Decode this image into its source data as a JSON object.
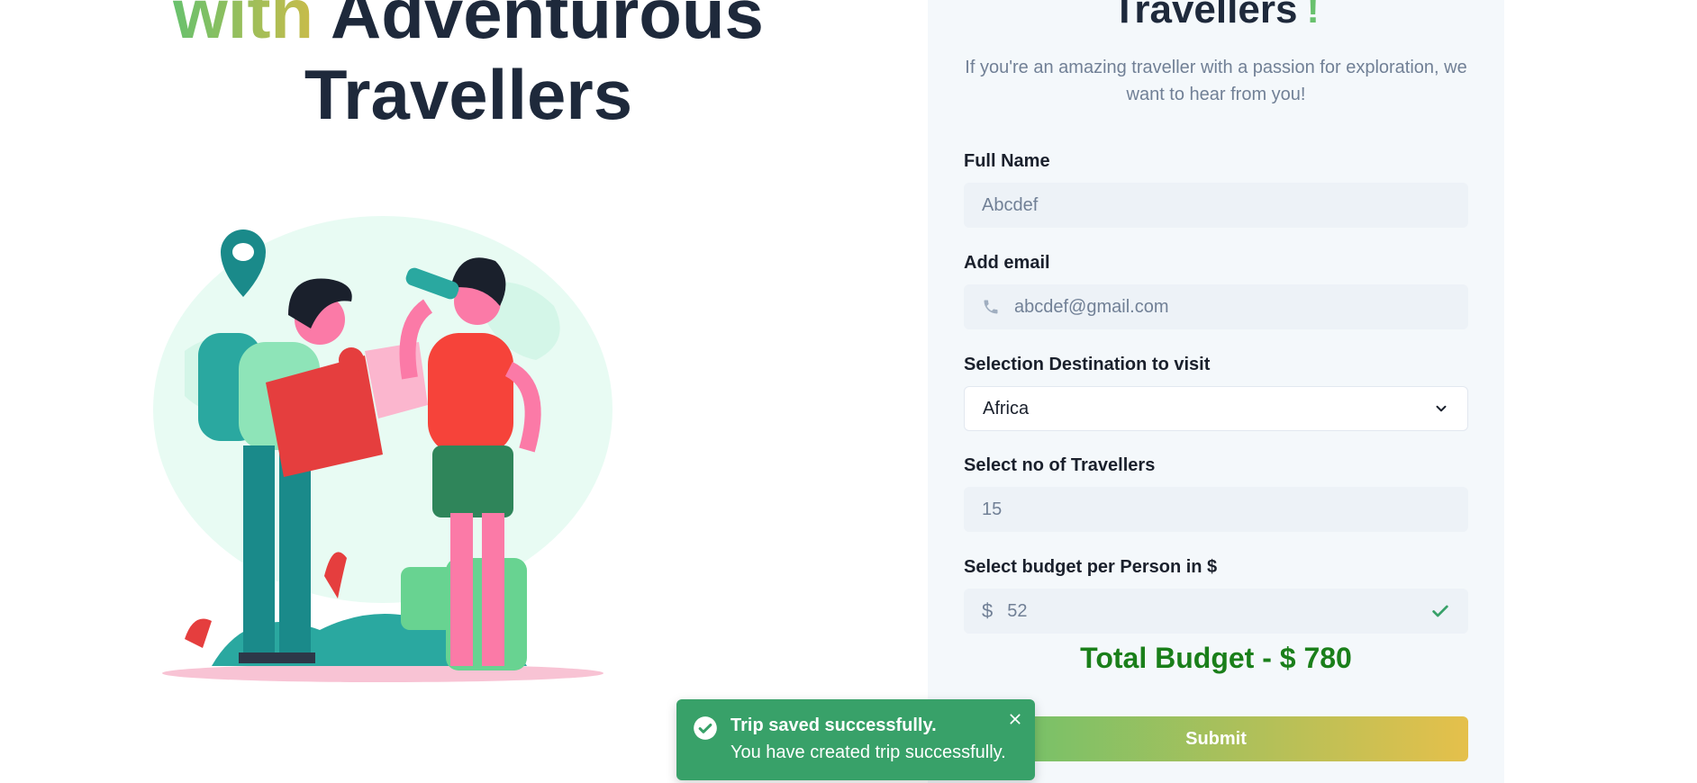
{
  "hero": {
    "line1_highlight": "with",
    "line1_rest": "Adventurous",
    "line2": "Travellers"
  },
  "form": {
    "title": "Travellers",
    "title_suffix": "!",
    "subtitle": "If you're an amazing traveller with a passion for exploration, we want to hear from you!",
    "name_label": "Full Name",
    "name_value": "Abcdef",
    "email_label": "Add email",
    "email_value": "abcdef@gmail.com",
    "destination_label": "Selection Destination to visit",
    "destination_value": "Africa",
    "travellers_label": "Select no of Travellers",
    "travellers_value": "15",
    "budget_label": "Select budget per Person in $",
    "budget_prefix": "$",
    "budget_value": "52",
    "total": "Total Budget - $ 780",
    "submit_label": "Submit"
  },
  "toast": {
    "title": "Trip saved successfully.",
    "description": "You have created trip successfully."
  },
  "colors": {
    "accent_green": "#68c16d",
    "accent_yellow": "#e5c04b",
    "total_green": "#1a7f1a",
    "toast_green": "#38a169"
  },
  "icons": {
    "email_prefix": "phone-icon",
    "select_arrow": "chevron-down-icon",
    "budget_valid": "check-icon",
    "toast_status": "check-circle-icon",
    "toast_close": "close-icon"
  }
}
